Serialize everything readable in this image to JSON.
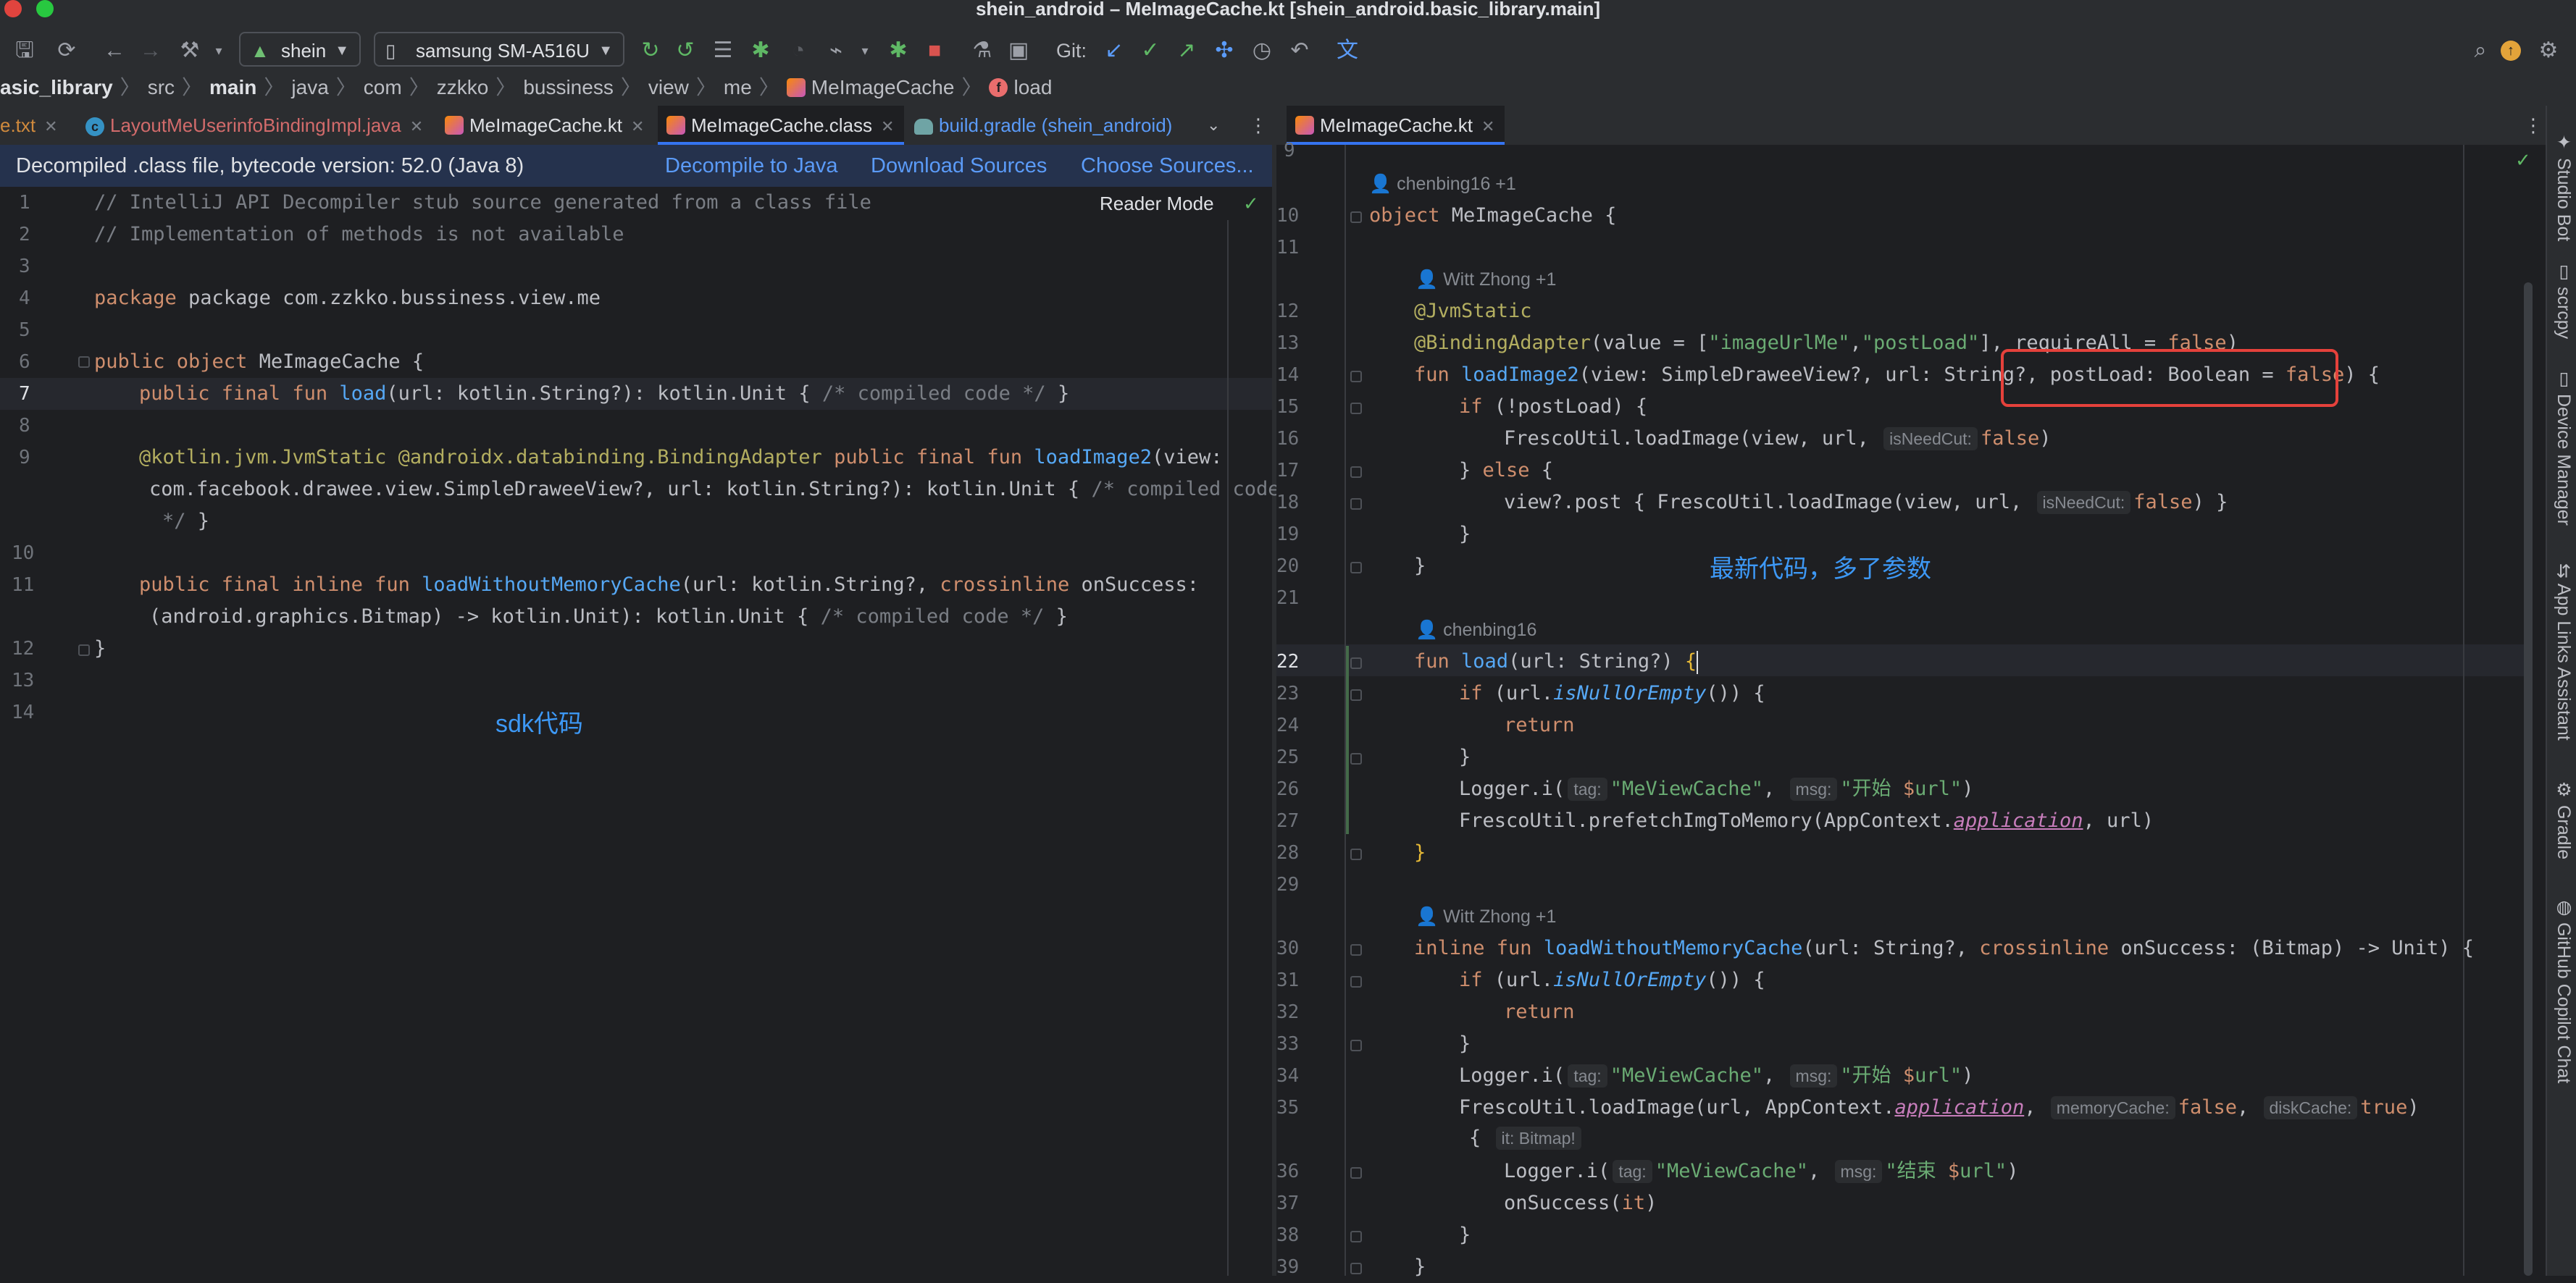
{
  "window": {
    "title": "shein_android – MeImageCache.kt [shein_android.basic_library.main]"
  },
  "toolbar": {
    "run_config": "shein",
    "device": "samsung SM-A516U",
    "git_label": "Git:",
    "icons": [
      "save-icon",
      "sync-icon",
      "back-icon",
      "forward-icon",
      "build-hammer-icon",
      "android-icon",
      "phone-icon",
      "rerun-icon",
      "apply-changes-icon",
      "list-icon",
      "debug-icon",
      "profile-icon",
      "attach-icon",
      "stop-icon",
      "sdk-manager-icon",
      "device-mirror-icon",
      "git-update-icon",
      "git-commit-icon",
      "git-push-icon",
      "git-merge-icon",
      "history-icon",
      "rollback-icon",
      "translate-icon",
      "search-icon",
      "update-icon",
      "settings-icon"
    ]
  },
  "breadcrumb": [
    "asic_library",
    "src",
    "main",
    "java",
    "com",
    "zzkko",
    "bussiness",
    "view",
    "me",
    "MeImageCache",
    "load"
  ],
  "left_tabs": [
    {
      "label": "e.txt",
      "color": "#d08a3d"
    },
    {
      "label": "LayoutMeUserinfoBindingImpl.java",
      "color": "#d26b6b"
    },
    {
      "label": "MeImageCache.kt",
      "color": "#dfe1e5"
    },
    {
      "label": "MeImageCache.class",
      "color": "#dfe1e5"
    },
    {
      "label": "build.gradle (shein_android)",
      "color": "#5b9bf8"
    }
  ],
  "right_tabs": [
    {
      "label": "MeImageCache.kt"
    }
  ],
  "banner": {
    "text": "Decompiled .class file, bytecode version: 52.0 (Java 8)",
    "decompile": "Decompile to Java",
    "download": "Download Sources",
    "choose": "Choose Sources..."
  },
  "reader_mode": "Reader Mode",
  "left_caption": "sdk代码",
  "right_caption": "最新代码，多了参数",
  "right_strip": [
    "Studio Bot",
    "scrcpy",
    "Device Manager",
    "App Links Assistant",
    "Gradle",
    "GitHub Copilot Chat"
  ],
  "left_code": {
    "line_numbers": [
      "1",
      "2",
      "3",
      "4",
      "5",
      "6",
      "7",
      "8",
      "9",
      "",
      "10",
      "11",
      "",
      "12",
      "13",
      "14"
    ],
    "lines": [
      "// IntelliJ API Decompiler stub source generated from a class file",
      "// Implementation of methods is not available",
      "package com.zzkko.bussiness.view.me",
      "public object MeImageCache {",
      "public final fun load(url: kotlin.String?): kotlin.Unit { /* compiled code */ }",
      "@kotlin.jvm.JvmStatic @androidx.databinding.BindingAdapter public final fun loadImage2(view:",
      "com.facebook.drawee.view.SimpleDraweeView?, url: kotlin.String?): kotlin.Unit { /* compiled code",
      "*/ }",
      "public final inline fun loadWithoutMemoryCache(url: kotlin.String?, crossinline onSuccess:",
      "(android.graphics.Bitmap) -> kotlin.Unit): kotlin.Unit { /* compiled code */ }",
      "}"
    ]
  },
  "right_code": {
    "line_numbers": [
      "9",
      "10",
      "11",
      "12",
      "13",
      "14",
      "15",
      "16",
      "17",
      "18",
      "19",
      "20",
      "21",
      "22",
      "23",
      "24",
      "25",
      "26",
      "27",
      "28",
      "29",
      "30",
      "31",
      "32",
      "33",
      "34",
      "35",
      "36",
      "37",
      "38",
      "39"
    ],
    "authors": [
      "chenbing16 +1",
      "Witt Zhong +1",
      "chenbing16",
      "Witt Zhong +1"
    ],
    "hints": [
      "isNeedCut:",
      "isNeedCut:",
      "tag:",
      "msg:",
      "tag:",
      "msg:",
      "memoryCache:",
      "diskCache:",
      "it: Bitmap!",
      "tag:",
      "msg:"
    ],
    "lines": [
      "object MeImageCache {",
      "@JvmStatic",
      "@BindingAdapter(value = [\"imageUrlMe\",\"postLoad\"], requireAll = false)",
      "fun loadImage2(view: SimpleDraweeView?, url: String?, postLoad: Boolean = false) {",
      "if (!postLoad) {",
      "FrescoUtil.loadImage(view, url, false)",
      "} else {",
      "view?.post { FrescoUtil.loadImage(view, url, false) }",
      "}",
      "}",
      "fun load(url: String?) {",
      "if (url.isNullOrEmpty()) {",
      "return",
      "}",
      "Logger.i(\"MeViewCache\", \"开始 $url\")",
      "FrescoUtil.prefetchImgToMemory(AppContext.application, url)",
      "}",
      "inline fun loadWithoutMemoryCache(url: String?, crossinline onSuccess: (Bitmap) -> Unit) {",
      "if (url.isNullOrEmpty()) {",
      "return",
      "}",
      "Logger.i(\"MeViewCache\", \"开始 $url\")",
      "FrescoUtil.loadImage(url, AppContext.application, false, true)",
      "{",
      "Logger.i(\"MeViewCache\", \"结束 $url\")",
      "onSuccess(it)",
      "}",
      "}"
    ]
  },
  "colors": {
    "accent": "#3574f0",
    "highlight_box": "#e5413b",
    "caption": "#3d98f5"
  }
}
